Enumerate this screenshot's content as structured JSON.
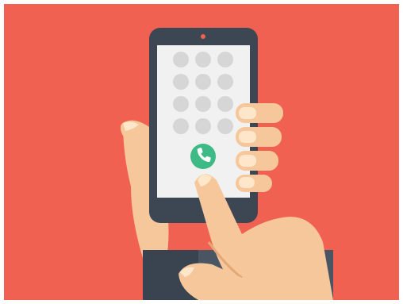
{
  "illustration": {
    "subject": "hand-holding-smartphone-dialer",
    "icons": [
      "phone-icon"
    ],
    "keypad": {
      "rows": 4,
      "cols": 3
    },
    "colors": {
      "background": "#f16152",
      "phone_body": "#3d4753",
      "screen": "#f1f1f1",
      "keypad_dot": "#d6d6d6",
      "call_button": "#3dba85",
      "skin": "#f6c79a",
      "skin_shadow": "#e4a877",
      "nail": "#fde6c9",
      "sleeve": "#4a5563",
      "sleeve_dark": "#3a4350"
    }
  }
}
